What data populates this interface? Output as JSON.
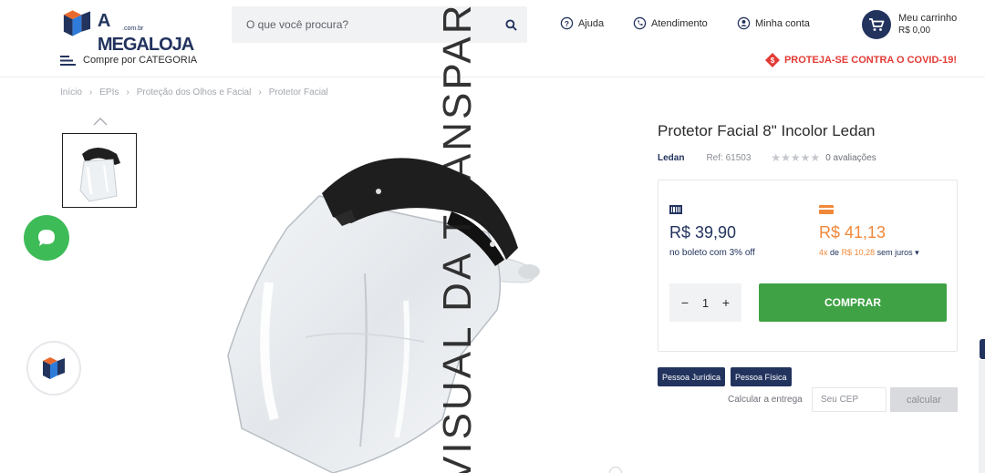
{
  "header": {
    "logo_text": "A MEGALOJA",
    "logo_sub": ".com.br",
    "search": {
      "placeholder": "O que você procura?"
    },
    "links": [
      {
        "label": "Ajuda",
        "icon": "help-circle-icon"
      },
      {
        "label": "Atendimento",
        "icon": "phone-icon"
      },
      {
        "label": "Minha conta",
        "icon": "user-circle-icon"
      }
    ],
    "cart": {
      "label": "Meu carrinho",
      "total": "R$ 0,00"
    }
  },
  "nav": {
    "category_label": "Compre por CATEGORIA",
    "covid_label": "PROTEJA-SE CONTRA O COVID-19!"
  },
  "breadcrumb": [
    "Início",
    "EPIs",
    "Proteção dos Olhos e Facial",
    "Protetor Facial"
  ],
  "watermark_text": "VISUAL DA TRANSPARÊNCIA",
  "product": {
    "title": "Protetor Facial 8\" Incolor Ledan",
    "brand": "Ledan",
    "ref": "Ref: 61503",
    "reviews": "0 avaliações",
    "rating": 0,
    "boleto_price": "R$ 39,90",
    "boleto_note": "no boleto com 3% off",
    "card_price": "R$ 41,13",
    "installments_count": "4x",
    "installments_de": "de",
    "installments_value": "R$ 10,28",
    "installments_note": "sem juros",
    "quantity": "1",
    "buy_label": "COMPRAR"
  },
  "shipping": {
    "person_types": [
      "Pessoa Jurídica",
      "Pessoa Física"
    ],
    "label": "Calcular a entrega",
    "cep_placeholder": "Seu CEP",
    "button": "calcular"
  },
  "colors": {
    "navy": "#22335e",
    "green": "#3fa245",
    "orange": "#f0883a",
    "red": "#e23b36",
    "chat_green": "#3dbb57"
  }
}
